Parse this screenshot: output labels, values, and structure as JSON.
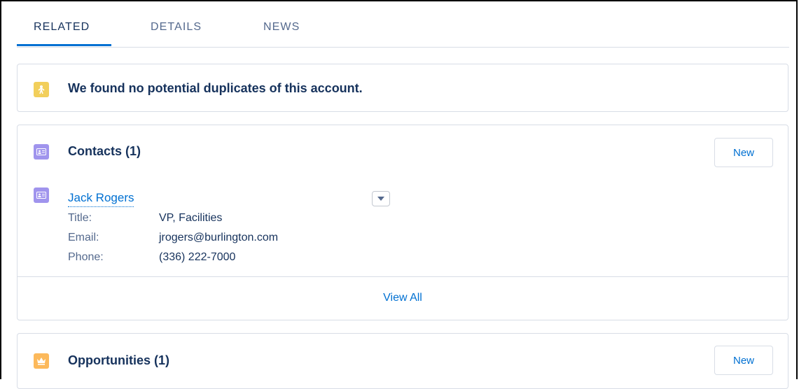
{
  "tabs": [
    {
      "label": "RELATED"
    },
    {
      "label": "DETAILS"
    },
    {
      "label": "NEWS"
    }
  ],
  "duplicates": {
    "message": "We found no potential duplicates of this account.",
    "icon": "duplicate-person-icon"
  },
  "contacts": {
    "title": "Contacts (1)",
    "new_label": "New",
    "view_all_label": "View All",
    "icon": "contact-card-icon",
    "items": [
      {
        "name": "Jack Rogers",
        "fields": [
          {
            "label": "Title:",
            "value": "VP, Facilities"
          },
          {
            "label": "Email:",
            "value": "jrogers@burlington.com"
          },
          {
            "label": "Phone:",
            "value": "(336) 222-7000"
          }
        ]
      }
    ]
  },
  "opportunities": {
    "title": "Opportunities (1)",
    "new_label": "New",
    "icon": "crown-icon"
  },
  "colors": {
    "accent": "#0070d2",
    "contact_icon": "#a094ed",
    "duplicate_icon": "#f2cf5b",
    "opportunity_icon": "#fcb95b"
  }
}
